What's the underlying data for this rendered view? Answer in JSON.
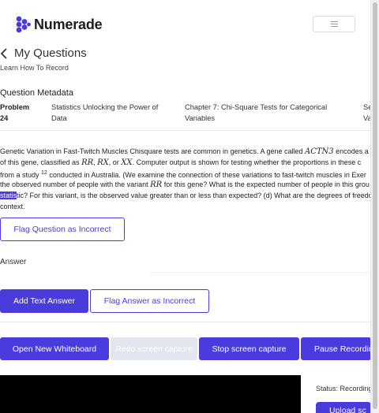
{
  "brand": {
    "name": "Numerade",
    "accent": "#4a3cdc"
  },
  "header": {
    "menu_icon": "hamburger-icon"
  },
  "page": {
    "title": "My Questions",
    "sub_link": "Learn How To Record"
  },
  "metadata": {
    "heading": "Question Metadata",
    "problem_label": "Problem",
    "problem_number": "24",
    "book": "Statistics Unlocking the Power of Data",
    "chapter": "Chapter 7: Chi-Square Tests for Categorical Variables",
    "extra": "Se Va"
  },
  "question": {
    "l1a": "Genetic Variation in Fast-Twitch Muscles Chisquare tests are common in genetics. A gene called ",
    "l1b": "ACTN3",
    "l1c": " encodes a p",
    "l2a": "of this gene, classified as ",
    "l2b": "RR",
    "l2c": ", ",
    "l2d": "RX",
    "l2e": ", or ",
    "l2f": "XX",
    "l2g": ". Computer output is shown for testing whether the proportions in these c",
    "l3a": "from a study ",
    "l3sup": "12",
    "l3b": " conducted in Australia. (We examine the connection of these variations to fast-twitch muscles in Exer",
    "l4a": "the observed number of people with the variant ",
    "l4b": "RR",
    "l4c": " for this gene? What is the expected number of people in this grou",
    "l5hl": "statis",
    "l5b": "tic? For this variant, is the observed value greater than or less than expected? (d) What are the degrees of freedo",
    "l6": "context."
  },
  "buttons": {
    "flag_question": "Flag Question as Incorrect",
    "add_text_answer": "Add Text Answer",
    "flag_answer": "Flag Answer as Incorrect",
    "open_whiteboard": "Open New Whiteboard",
    "redo_capture": "Redo screen capture",
    "stop_capture": "Stop screen capture",
    "pause_recording": "Pause Recording",
    "upload": "Upload sc"
  },
  "answer": {
    "label": "Answer"
  },
  "recording": {
    "status": "Status: Recording"
  }
}
